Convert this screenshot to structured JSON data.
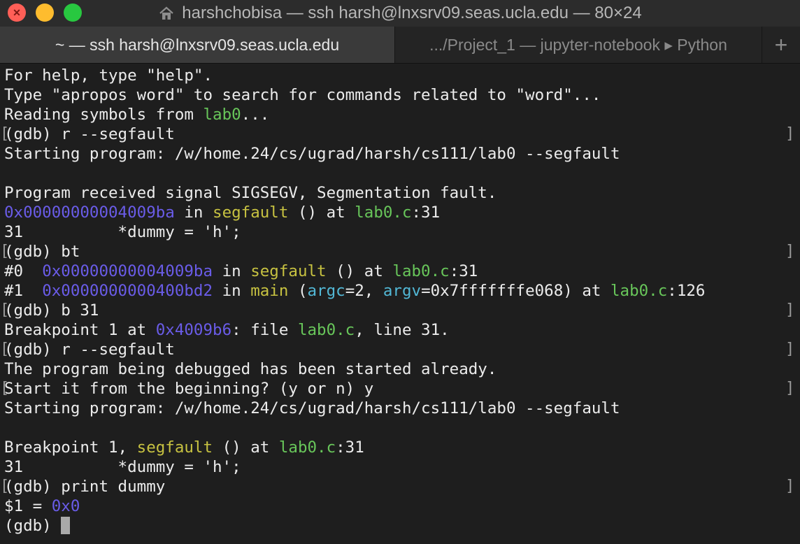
{
  "window": {
    "title": "harshchobisa — ssh harsh@lnxsrv09.seas.ucla.edu — 80×24"
  },
  "tabs": [
    {
      "label": "~ — ssh harsh@lnxsrv09.seas.ucla.edu"
    },
    {
      "label": ".../Project_1 — jupyter-notebook ▸ Python"
    }
  ],
  "tab_add_label": "+",
  "colors": {
    "address": "#6a5ce8",
    "function": "#c7c241",
    "file": "#68c65a",
    "argument": "#52b8d6"
  },
  "terminal": {
    "l1": "For help, type \"help\".",
    "l2": "Type \"apropos word\" to search for commands related to \"word\"...",
    "l3a": "Reading symbols from ",
    "l3b": "lab0",
    "l3c": "...",
    "l4": "(gdb) r --segfault",
    "l5": "Starting program: /w/home.24/cs/ugrad/harsh/cs111/lab0 --segfault",
    "l7": "Program received signal SIGSEGV, Segmentation fault.",
    "l8a": "0x00000000004009ba",
    "l8b": " in ",
    "l8c": "segfault",
    "l8d": " () at ",
    "l8e": "lab0.c",
    "l8f": ":31",
    "l9": "31          *dummy = 'h';",
    "l10": "(gdb) bt",
    "l11a": "#0  ",
    "l11b": "0x00000000004009ba",
    "l11c": " in ",
    "l11d": "segfault",
    "l11e": " () at ",
    "l11f": "lab0.c",
    "l11g": ":31",
    "l12a": "#1  ",
    "l12b": "0x0000000000400bd2",
    "l12c": " in ",
    "l12d": "main",
    "l12e": " (",
    "l12f": "argc",
    "l12g": "=2, ",
    "l12h": "argv",
    "l12i": "=0x7fffffffe068) at ",
    "l12j": "lab0.c",
    "l12k": ":126",
    "l13": "(gdb) b 31",
    "l14a": "Breakpoint 1 at ",
    "l14b": "0x4009b6",
    "l14c": ": file ",
    "l14d": "lab0.c",
    "l14e": ", line 31.",
    "l15": "(gdb) r --segfault",
    "l16": "The program being debugged has been started already.",
    "l17": "Start it from the beginning? (y or n) y",
    "l18": "Starting program: /w/home.24/cs/ugrad/harsh/cs111/lab0 --segfault",
    "l20a": "Breakpoint 1, ",
    "l20b": "segfault",
    "l20c": " () at ",
    "l20d": "lab0.c",
    "l20e": ":31",
    "l21": "31          *dummy = 'h';",
    "l22": "(gdb) print dummy",
    "l23a": "$1 = ",
    "l23b": "0x0",
    "l24": "(gdb) "
  }
}
